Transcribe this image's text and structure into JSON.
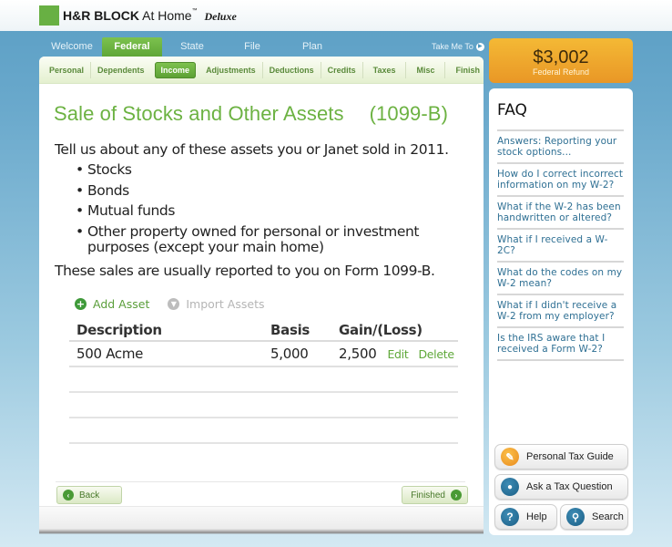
{
  "brand": {
    "name": "H&R BLOCK",
    "product": "At Home",
    "trademark": "™",
    "edition": "Deluxe",
    "accent_color": "#68b043"
  },
  "main_tabs": [
    {
      "label": "Welcome",
      "active": false
    },
    {
      "label": "Federal",
      "active": true
    },
    {
      "label": "State",
      "active": false
    },
    {
      "label": "File",
      "active": false
    },
    {
      "label": "Plan",
      "active": false
    }
  ],
  "take_me_to": {
    "label": "Take Me To",
    "icon": "arrow-right-circle-icon"
  },
  "sub_tabs": [
    {
      "label": "Personal",
      "active": false
    },
    {
      "label": "Dependents",
      "active": false
    },
    {
      "label": "Income",
      "active": true
    },
    {
      "label": "Adjustments",
      "active": false
    },
    {
      "label": "Deductions",
      "active": false
    },
    {
      "label": "Credits",
      "active": false
    },
    {
      "label": "Taxes",
      "active": false
    },
    {
      "label": "Misc",
      "active": false
    },
    {
      "label": "Finish",
      "active": false
    }
  ],
  "page": {
    "title": "Sale of Stocks and Other Assets",
    "form_code": "(1099-B)",
    "intro": "Tell us about any of these assets you or Janet sold in 2011.",
    "bullets": [
      "Stocks",
      "Bonds",
      "Mutual funds",
      "Other property owned for personal or investment purposes (except your main home)"
    ],
    "outro": "These sales are usually reported to you on Form 1099-B."
  },
  "actions": {
    "add_label": "Add Asset",
    "add_icon": "plus-circle-icon",
    "import_label": "Import Assets",
    "import_icon": "download-circle-icon"
  },
  "table": {
    "headers": [
      "Description",
      "Basis",
      "Gain/(Loss)"
    ],
    "rows": [
      {
        "description": "500 Acme",
        "basis": "5,000",
        "gain": "2,500",
        "edit_label": "Edit",
        "delete_label": "Delete"
      }
    ],
    "empty_rows": 3
  },
  "nav_buttons": {
    "back_label": "Back",
    "finished_label": "Finished"
  },
  "refund": {
    "amount": "$3,002",
    "label": "Federal Refund",
    "color": "#f0a52c"
  },
  "faq": {
    "title": "FAQ",
    "items": [
      "Answers: Reporting your stock options...",
      "How do I correct incorrect information on my W-2?",
      "What if the W-2 has been handwritten or altered?",
      "What if I received a W-2C?",
      "What do the codes on my W-2 mean?",
      "What if I didn't receive a W-2 from my employer?",
      "Is the IRS aware that I received a Form W-2?"
    ],
    "link_color": "#2e6f93"
  },
  "side_buttons": {
    "guide_label": "Personal Tax Guide",
    "ask_label": "Ask a Tax Question",
    "help_label": "Help",
    "search_label": "Search"
  }
}
